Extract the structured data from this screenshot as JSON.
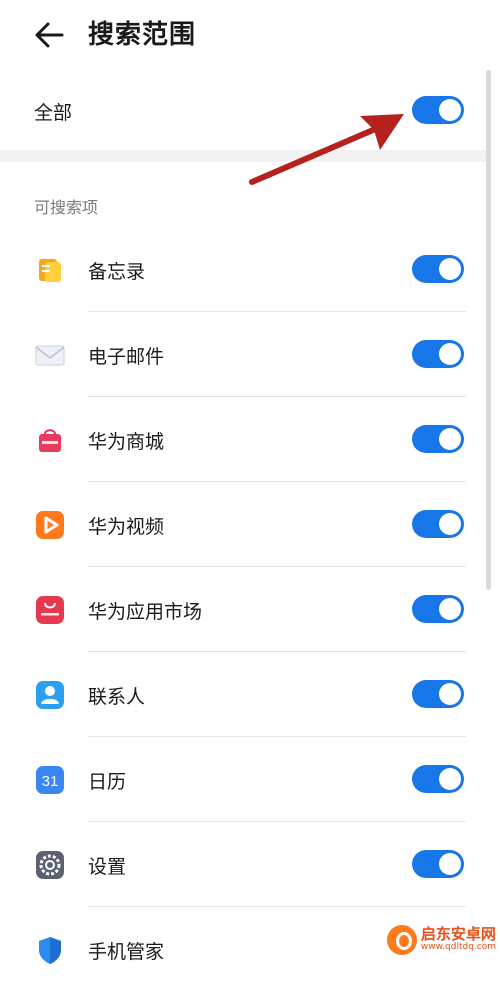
{
  "header": {
    "title": "搜索范围",
    "back_icon": "arrow-left-icon"
  },
  "all": {
    "label": "全部",
    "enabled": true
  },
  "section": {
    "title": "可搜索项"
  },
  "items": [
    {
      "label": "备忘录",
      "icon": "notes-icon",
      "enabled": true
    },
    {
      "label": "电子邮件",
      "icon": "email-icon",
      "enabled": true
    },
    {
      "label": "华为商城",
      "icon": "vmall-icon",
      "enabled": true
    },
    {
      "label": "华为视频",
      "icon": "video-icon",
      "enabled": true
    },
    {
      "label": "华为应用市场",
      "icon": "appgallery-icon",
      "enabled": true
    },
    {
      "label": "联系人",
      "icon": "contacts-icon",
      "enabled": true
    },
    {
      "label": "日历",
      "icon": "calendar-icon",
      "enabled": true,
      "icon_text": "31"
    },
    {
      "label": "设置",
      "icon": "settings-icon",
      "enabled": true
    },
    {
      "label": "手机管家",
      "icon": "phone-manager-icon",
      "enabled": true
    }
  ],
  "watermark": {
    "name": "启东安卓网",
    "url": "www.qdltdq.com"
  },
  "colors": {
    "accent": "#1877e8",
    "arrow": "#b5221e"
  }
}
